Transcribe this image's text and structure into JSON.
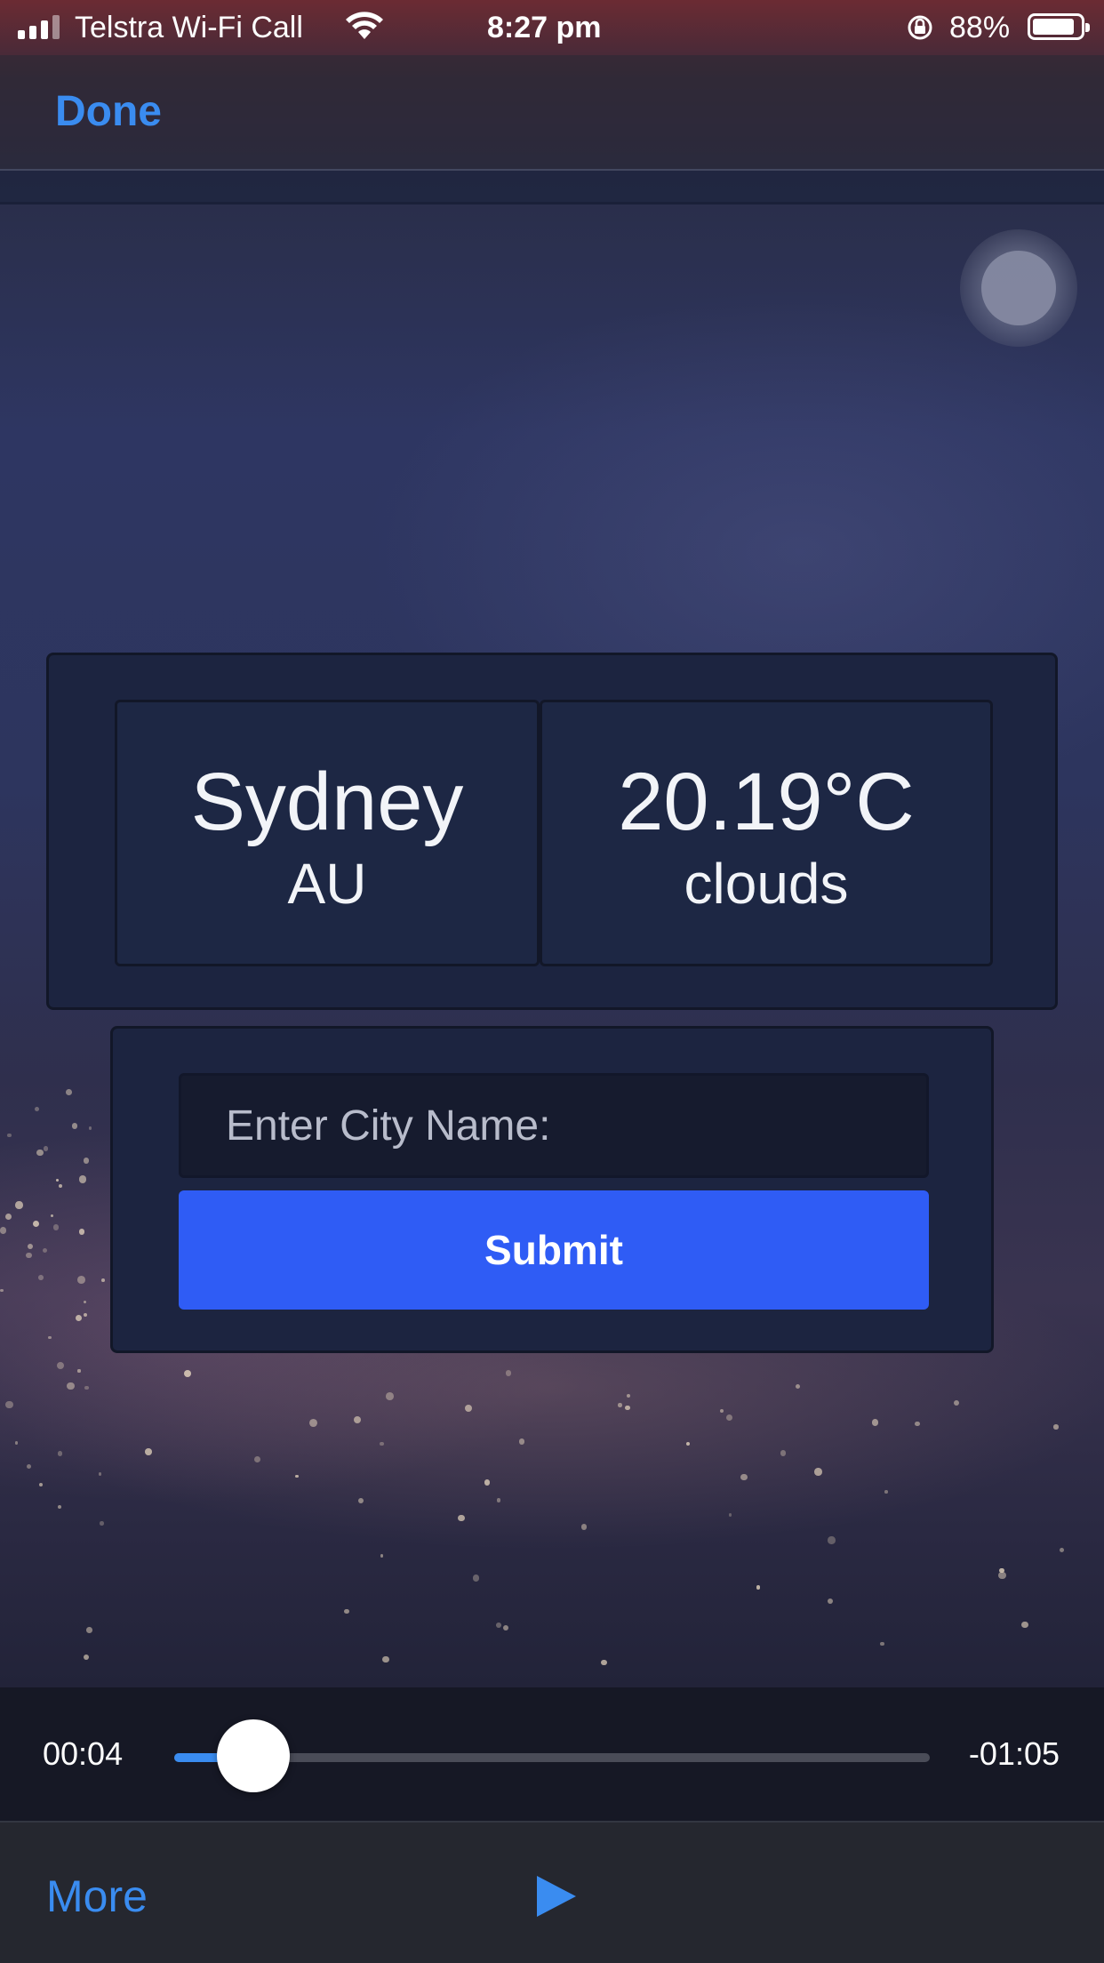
{
  "status_bar": {
    "carrier": "Telstra Wi-Fi Call",
    "time": "8:27 pm",
    "battery_percent": "88%",
    "battery_level": 0.88,
    "icons": [
      "signal-icon",
      "wifi-icon",
      "orientation-lock-icon",
      "battery-icon"
    ]
  },
  "nav": {
    "done_label": "Done"
  },
  "weather": {
    "city": "Sydney",
    "country": "AU",
    "temperature": "20.19°C",
    "condition": "clouds"
  },
  "form": {
    "city_input_placeholder": "Enter City Name:",
    "city_input_value": "",
    "submit_label": "Submit",
    "accent_color": "#2f5cf5"
  },
  "playback": {
    "elapsed": "00:04",
    "remaining": "-01:05",
    "progress": 0.06,
    "accent_color": "#3a8cf0"
  },
  "toolbar": {
    "more_label": "More",
    "play_icon": "play-icon"
  }
}
